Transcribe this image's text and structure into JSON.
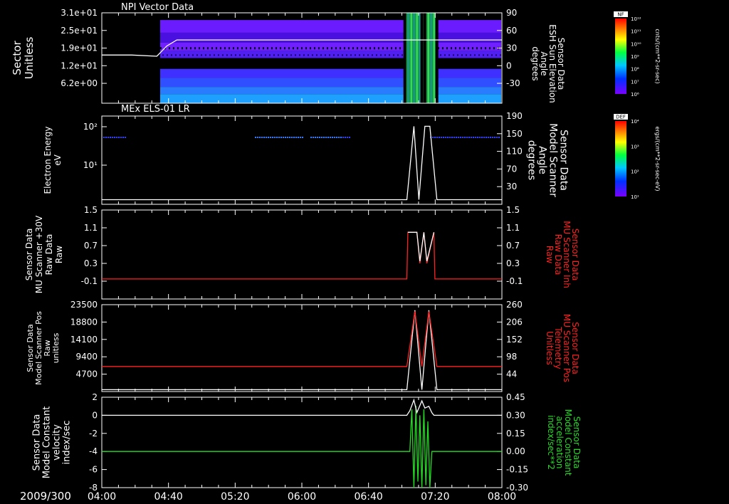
{
  "date_label": "2009/300",
  "time_ticks": [
    "04:00",
    "04:40",
    "05:20",
    "06:00",
    "06:40",
    "07:20",
    "08:00"
  ],
  "colors": {
    "white": "#ffffff",
    "red": "#ff2020",
    "green": "#22dd22"
  },
  "colorbars": [
    {
      "tag": "NF",
      "unit": "cnts/(cm**2-sr-sec)",
      "ticks": [
        "10¹²",
        "10¹¹",
        "10¹⁰",
        "10⁹",
        "10⁸",
        "10⁷",
        "10⁶"
      ]
    },
    {
      "tag": "DEF",
      "unit": "ergs/(cm**2-sr-sec-eV)",
      "ticks": [
        "10⁴",
        "10³",
        "10²",
        "10¹"
      ]
    }
  ],
  "chart_data": [
    {
      "type": "heatmap",
      "title": "NPI Vector Data",
      "ylabel": [
        "Sector",
        "Unitless"
      ],
      "yticks": [
        "3.1e+01",
        "2.5e+01",
        "1.9e+01",
        "1.2e+01",
        "6.2e+00"
      ],
      "y2label": [
        "Sensor Data",
        "ESH Sun Elevation",
        "Angle",
        "degrees"
      ],
      "y2ticks": [
        "90",
        "60",
        "30",
        "0",
        "-30"
      ],
      "y2lim": [
        -60,
        90
      ],
      "overlay_series": {
        "name": "ESH Sun Elevation Angle",
        "x_hours": [
          4.0,
          4.3,
          4.55,
          4.65,
          4.75,
          7.0,
          8.0
        ],
        "y": [
          20,
          20,
          18,
          35,
          45,
          45,
          45
        ]
      },
      "heatmap_data_start": "04:35",
      "heatmap_gaps": [
        "07:02",
        "07:12-07:15",
        "07:22"
      ]
    },
    {
      "type": "line",
      "title": "MEx ELS-01 LR",
      "ylabel": [
        "Electron Energy",
        "eV"
      ],
      "yticks": [
        "10²",
        "10¹"
      ],
      "y2label": [
        "Sensor Data",
        "Model Scanner",
        "Angle",
        "degrees"
      ],
      "y2ticks": [
        "190",
        "150",
        "110",
        "70",
        "30"
      ],
      "y2lim": [
        0,
        190
      ],
      "series": [
        {
          "name": "Model Scanner Angle",
          "x_hours": [
            4.0,
            7.05,
            7.12,
            7.17,
            7.23,
            7.28,
            7.35,
            8.0
          ],
          "y": [
            10,
            10,
            168,
            10,
            168,
            168,
            10,
            10
          ]
        }
      ]
    },
    {
      "type": "line",
      "ylabel": [
        "Sensor Data",
        "MU Scanner +30V",
        "Raw Data",
        "Raw"
      ],
      "yticks": [
        "1.5",
        "1.1",
        "0.7",
        "0.3",
        "-0.1"
      ],
      "ylim": [
        -0.5,
        1.5
      ],
      "y2label": [
        "Sensor Data",
        "MU Scanner Inh",
        "Raw Data",
        "Raw"
      ],
      "y2ticks": [
        "1.5",
        "1.1",
        "0.7",
        "0.3",
        "-0.1"
      ],
      "y2lim": [
        -0.5,
        1.5
      ],
      "series": [
        {
          "name": "MU Scanner Inh Raw Data",
          "x_hours": [
            4.0,
            7.05,
            7.06,
            7.15,
            7.18,
            7.22,
            7.25,
            7.32,
            7.33,
            8.0
          ],
          "y": [
            -0.05,
            -0.05,
            1.0,
            1.0,
            0.3,
            1.0,
            0.3,
            1.0,
            -0.05,
            -0.05
          ]
        }
      ]
    },
    {
      "type": "line",
      "ylabel": [
        "Sensor Data",
        "Model Scanner Pos",
        "Raw",
        "unitless"
      ],
      "yticks": [
        "23500",
        "18800",
        "14100",
        "9400",
        "4700"
      ],
      "ylim": [
        0,
        23500
      ],
      "y2label": [
        "Sensor Data",
        "MU Scanner Pos",
        "Telemetry",
        "Unitless"
      ],
      "y2ticks": [
        "260",
        "206",
        "152",
        "98",
        "44"
      ],
      "y2lim": [
        0,
        260
      ],
      "series": [
        {
          "name": "Model Scanner Pos Raw",
          "x_hours": [
            4.0,
            7.05,
            7.13,
            7.2,
            7.27,
            7.35,
            8.0
          ],
          "y": [
            500,
            500,
            22000,
            500,
            22000,
            500,
            500
          ]
        },
        {
          "name": "MU Scanner Pos Telemetry",
          "x_hours": [
            4.0,
            7.05,
            7.13,
            7.2,
            7.27,
            7.35,
            8.0
          ],
          "y2": [
            75,
            75,
            240,
            75,
            240,
            75,
            75
          ]
        }
      ]
    },
    {
      "type": "line",
      "ylabel": [
        "Sensor Data",
        "Model Constant",
        "velocity",
        "index/sec"
      ],
      "yticks": [
        "2",
        "0",
        "-2",
        "-4",
        "-6",
        "-8"
      ],
      "ylim": [
        -8,
        2
      ],
      "y2label": [
        "Sensor Data",
        "Model Constant",
        "acceleration",
        "index/sec**2"
      ],
      "y2ticks": [
        "0.45",
        "0.30",
        "0.15",
        "0.00",
        "-0.15",
        "-0.30"
      ],
      "y2lim": [
        -0.3,
        0.45
      ],
      "series": [
        {
          "name": "Model Constant velocity",
          "x_hours": [
            4.0,
            7.05,
            7.08,
            7.12,
            7.15,
            7.2,
            7.23,
            7.27,
            7.3,
            7.32,
            8.0
          ],
          "y": [
            0,
            0,
            0.5,
            1.7,
            0.3,
            1.6,
            0.8,
            1.0,
            0.3,
            0,
            0
          ]
        },
        {
          "name": "Model Constant acceleration",
          "x_hours": [
            4.0,
            7.08,
            7.1,
            7.12,
            7.14,
            7.16,
            7.18,
            7.2,
            7.22,
            7.24,
            7.26,
            7.28,
            7.3,
            8.0
          ],
          "y2": [
            0.0,
            0.0,
            0.35,
            -0.3,
            0.38,
            -0.25,
            0.3,
            -0.3,
            0.35,
            -0.28,
            0.25,
            -0.3,
            0.0,
            0.0
          ]
        }
      ]
    }
  ]
}
